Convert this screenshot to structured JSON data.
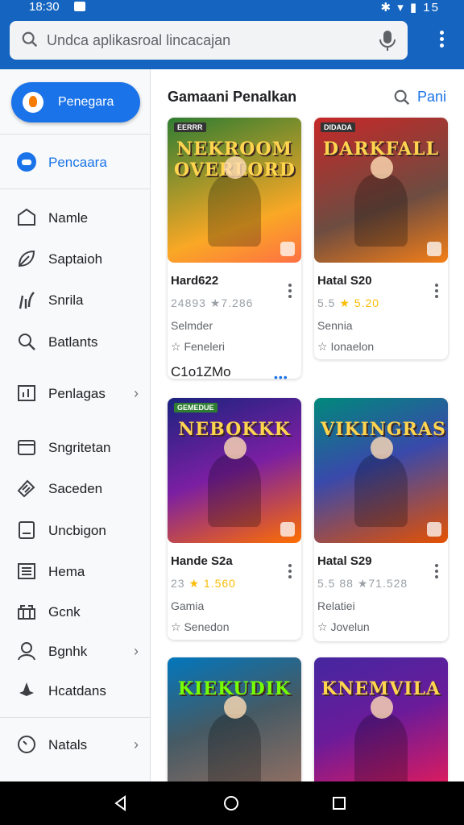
{
  "status": {
    "time": "18:30",
    "right": "✱ ▾ ▮ 15"
  },
  "search": {
    "placeholder": "Undca aplikasroal lincacajan"
  },
  "sidebar": {
    "fab_label": "Penegara",
    "items": [
      {
        "label": "Pencaara",
        "icon": "game-controller-icon",
        "active": true
      },
      {
        "label": "Namle",
        "icon": "home-icon"
      },
      {
        "label": "Saptaioh",
        "icon": "leaf-icon"
      },
      {
        "label": "Snrila",
        "icon": "sparkle-icon"
      },
      {
        "label": "Batlants",
        "icon": "search-icon"
      },
      {
        "label": "Penlagas",
        "icon": "chart-icon",
        "chevron": "›"
      },
      {
        "label": "Sngritetan",
        "icon": "folder-icon"
      },
      {
        "label": "Saceden",
        "icon": "tag-icon"
      },
      {
        "label": "Uncbigon",
        "icon": "monitor-icon"
      },
      {
        "label": "Hema",
        "icon": "newspaper-icon"
      },
      {
        "label": "Gcnk",
        "icon": "gift-icon"
      },
      {
        "label": "Bgnhk",
        "icon": "person-icon",
        "chevron": "›"
      },
      {
        "label": "Hcatdans",
        "icon": "pin-icon"
      },
      {
        "label": "Natals",
        "icon": "clock-icon",
        "chevron": "›"
      }
    ]
  },
  "main": {
    "section_title": "Gamaani Penalkan",
    "link": "Pani",
    "cards": [
      {
        "art": "NEKROOM OVERLORD",
        "badge": "EERRR",
        "title": "Hard622",
        "stats_a": "24893",
        "stats_b": "★7.286",
        "genre": "Selmder",
        "tag": "Feneleri",
        "extra": "C1o1ZMo",
        "extra_dots": "•••",
        "colors": [
          "#2e7d32",
          "#f9a825"
        ]
      },
      {
        "art": "DARKFALL",
        "badge": "DIDADA",
        "title": "Hatal S20",
        "stats_a": "5.5",
        "stats_b": "★ 5.20",
        "genre": "Sennia",
        "tag": "Ionaelon",
        "colors": [
          "#c62828",
          "#f57f17"
        ]
      },
      {
        "art": "NEBOKKK",
        "badge": "GEMEDUE",
        "title": "Hande S2a",
        "stats_a": "23",
        "stats_b": "★ 1.560",
        "genre": "Gamia",
        "tag": "Senedon",
        "colors": [
          "#1a237e",
          "#ff6f00"
        ]
      },
      {
        "art": "VIKINGRAS",
        "badge": "",
        "title": "Hatal S29",
        "stats_a": "5.5 88",
        "stats_b": "★71.528",
        "genre": "Relatiei",
        "tag": "Jovelun",
        "colors": [
          "#00897b",
          "#e65100"
        ]
      },
      {
        "art": "KIEKUDIK",
        "badge": "",
        "title": "",
        "colors": [
          "#0277bd",
          "#8d6e63"
        ]
      },
      {
        "art": "KNEMVILA",
        "badge": "",
        "title": "",
        "colors": [
          "#4527a0",
          "#d81b60"
        ]
      }
    ]
  },
  "colors": {
    "appbar": "#1565c0",
    "accent": "#1a73e8",
    "star": "#fbbc04"
  }
}
